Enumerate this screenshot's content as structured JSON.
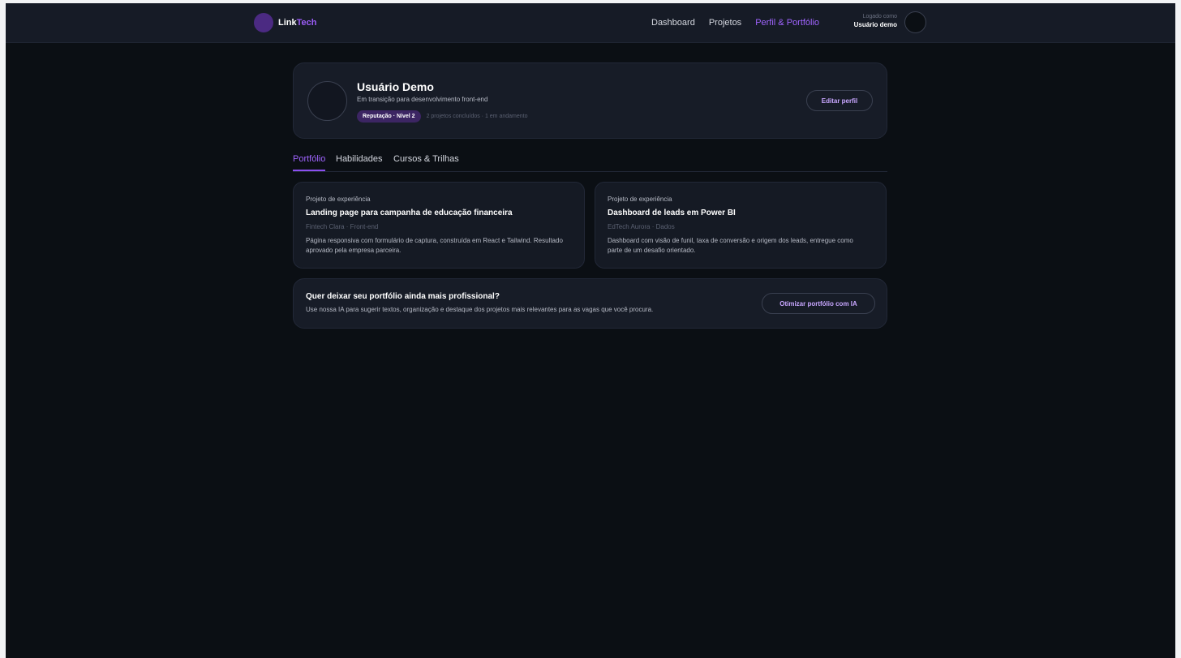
{
  "navbar": {
    "brand_main": "Link",
    "brand_accent": "Tech",
    "links": [
      "Dashboard",
      "Projetos",
      "Perfil & Portfólio"
    ],
    "active_link": "Perfil & Portfólio",
    "user_caption": "Logado como",
    "user_name": "Usuário demo"
  },
  "profile": {
    "name": "Usuário Demo",
    "subtitle": "Em transição para desenvolvimento front-end",
    "badge": "Reputação · Nível 2",
    "meta": "2 projetos concluídos · 1 em andamento",
    "edit_label": "Editar perfil"
  },
  "tabs": [
    "Portfólio",
    "Habilidades",
    "Cursos & Trilhas"
  ],
  "active_tab": "Portfólio",
  "projects": [
    {
      "kicker": "Projeto de experiência",
      "title": "Landing page para campanha de educação financeira",
      "org": "Fintech Clara · Front-end",
      "description": "Página responsiva com formulário de captura, construída em React e Tailwind. Resultado aprovado pela empresa parceira."
    },
    {
      "kicker": "Projeto de experiência",
      "title": "Dashboard de leads em Power BI",
      "org": "EdTech Aurora · Dados",
      "description": "Dashboard com visão de funil, taxa de conversão e origem dos leads, entregue como parte de um desafio orientado."
    }
  ],
  "cta": {
    "title": "Quer deixar seu portfólio ainda mais profissional?",
    "text": "Use nossa IA para sugerir textos, organização e destaque dos projetos mais relevantes para as vagas que você procura.",
    "button": "Otimizar portfólio com IA"
  },
  "colors": {
    "background": "#0b0f14",
    "accent": "#a064ff",
    "card": "#171c27"
  }
}
